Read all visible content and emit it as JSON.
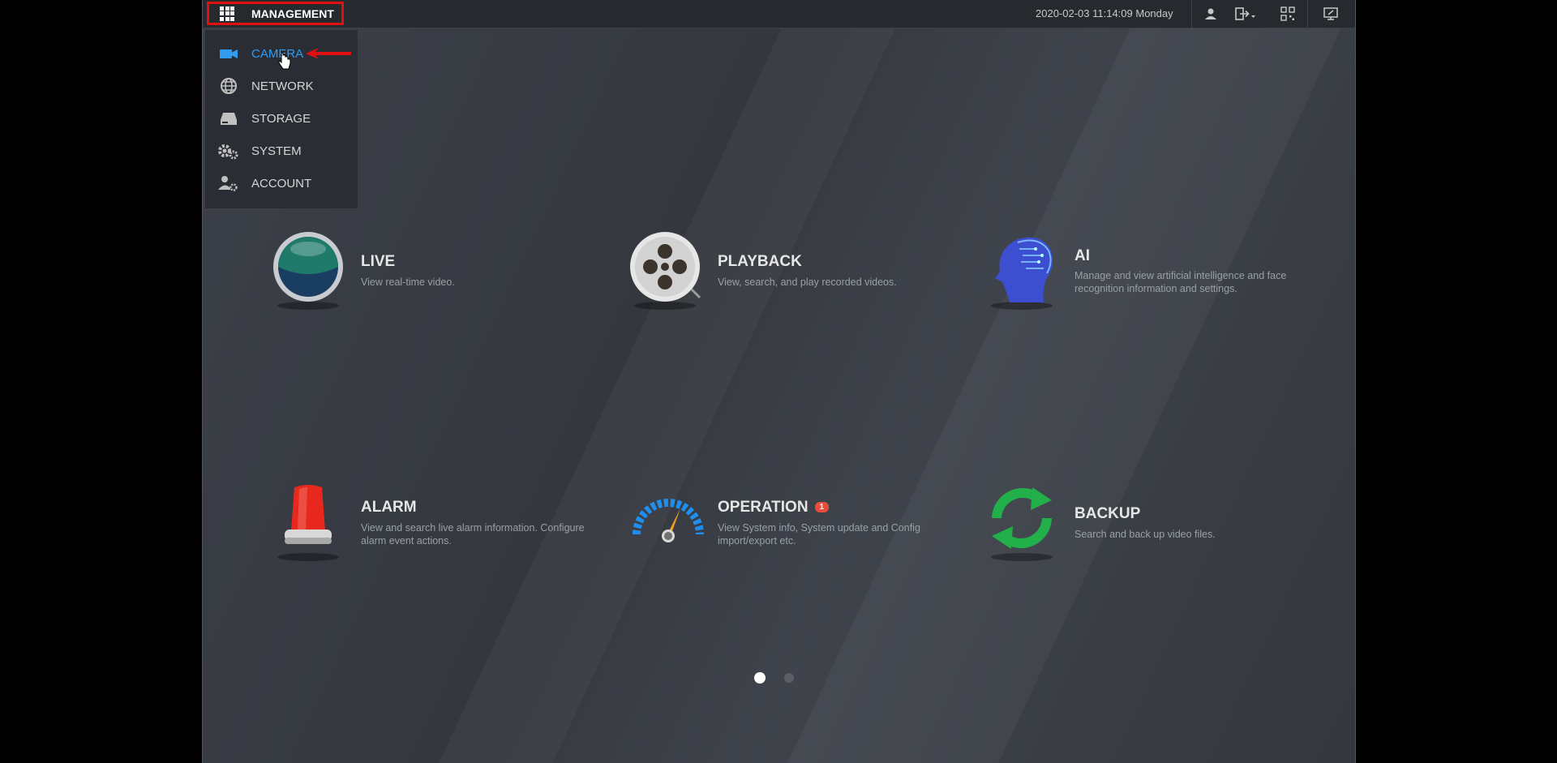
{
  "topbar": {
    "management_label": "MANAGEMENT",
    "datetime": "2020-02-03 11:14:09 Monday",
    "icons": [
      "user-icon",
      "logout-icon",
      "qr-code-icon",
      "display-icon"
    ]
  },
  "menu": {
    "items": [
      {
        "label": "CAMERA",
        "icon": "camera-icon",
        "active": true
      },
      {
        "label": "NETWORK",
        "icon": "network-globe-icon",
        "active": false
      },
      {
        "label": "STORAGE",
        "icon": "storage-disk-icon",
        "active": false
      },
      {
        "label": "SYSTEM",
        "icon": "gears-icon",
        "active": false
      },
      {
        "label": "ACCOUNT",
        "icon": "account-gear-icon",
        "active": false
      }
    ]
  },
  "tiles": [
    {
      "title": "LIVE",
      "desc": "View real-time video."
    },
    {
      "title": "PLAYBACK",
      "desc": "View, search, and play recorded videos."
    },
    {
      "title": "AI",
      "desc": "Manage and view artificial intelligence and face recognition information and settings."
    },
    {
      "title": "ALARM",
      "desc": "View and search live alarm information. Configure alarm event actions."
    },
    {
      "title": "OPERATION",
      "desc": "View System info, System update and Config import/export etc.",
      "badge": "1"
    },
    {
      "title": "BACKUP",
      "desc": "Search and back up video files."
    }
  ],
  "pagination": {
    "pages": 2,
    "current": 1
  },
  "colors": {
    "active": "#2f9df4",
    "highlight": "#e01010",
    "badge": "#e74c3c"
  }
}
